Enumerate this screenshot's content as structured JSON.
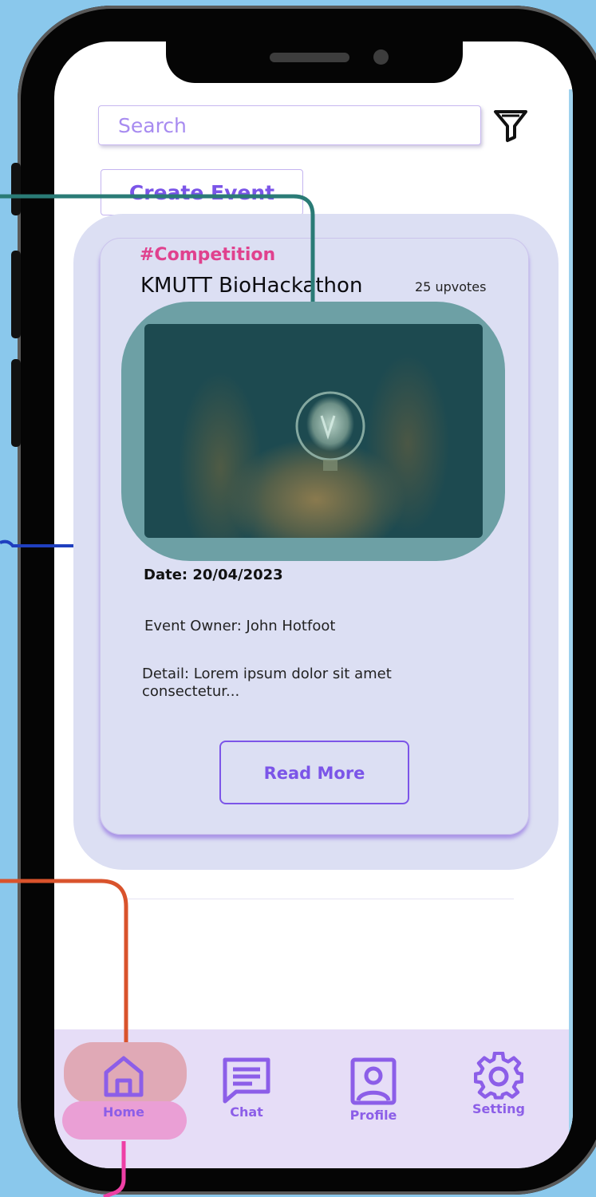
{
  "search": {
    "placeholder": "Search"
  },
  "toolbar": {
    "create_event_label": "Create Event"
  },
  "event_card": {
    "hashtag": "#Competition",
    "title": "KMUTT BioHackathon",
    "upvotes": "25 upvotes",
    "date": "Date: 20/04/2023",
    "owner": "Event Owner: John Hotfoot",
    "detail": "Detail: Lorem ipsum dolor sit amet consectetur...",
    "read_more_label": "Read More"
  },
  "nav": {
    "items": [
      {
        "label": "Home",
        "icon": "home-icon",
        "active": true
      },
      {
        "label": "Chat",
        "icon": "chat-icon",
        "active": false
      },
      {
        "label": "Profile",
        "icon": "profile-icon",
        "active": false
      },
      {
        "label": "Setting",
        "icon": "gear-icon",
        "active": false
      }
    ]
  },
  "colors": {
    "accent": "#7b55e8",
    "hashtag": "#e0418e",
    "card_bg": "#dcdff3",
    "nav_bg": "#e6ddf7",
    "background": "#8ac8ec"
  }
}
